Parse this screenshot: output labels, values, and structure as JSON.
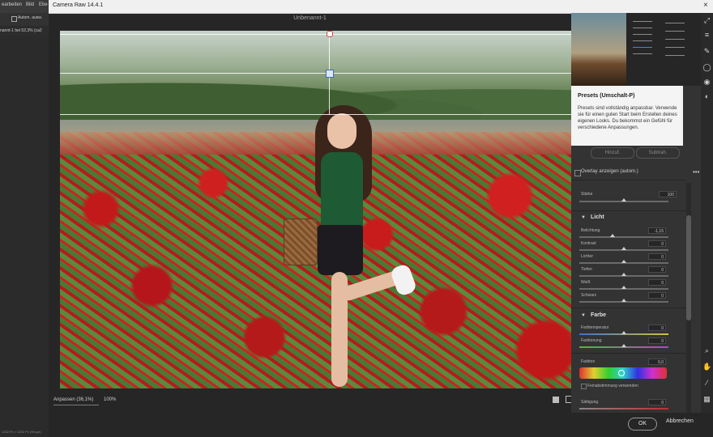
{
  "photoshop": {
    "menu": [
      "earbeiten",
      "Bild",
      "Ebe"
    ],
    "option_checkbox_label": "Autom. ausw.",
    "doc_tab": "nannt-1 bei 52,3% (ca2",
    "status": "1232 Px × 1232 Px (96 ppi)"
  },
  "camera_raw": {
    "window_title": "Camera Raw 14.4.1",
    "close_glyph": "×",
    "document_title": "Unbenannt-1",
    "zoom_menu": "Anpassen (36,1%)",
    "zoom_value": "100%"
  },
  "tooltip": {
    "title": "Presets (Umschalt-P)",
    "body": "Presets sind vollständig anpassbar. Verwende sie für einen guten Start beim Erstellen deines eigenen Looks. Du bekommst ein Gefühl für verschiedene Anpassungen."
  },
  "panel": {
    "add_label": "Hinzuf.",
    "subtract_label": "Subtrah.",
    "overlay_label": "Overlay anzeigen (autom.)",
    "more_glyph": "•••",
    "amount_label": "Stärke",
    "amount_value": "100",
    "light": {
      "title": "Licht",
      "sliders": [
        {
          "label": "Belichtung",
          "value": "-1,15"
        },
        {
          "label": "Kontrast",
          "value": "0"
        },
        {
          "label": "Lichter",
          "value": "0"
        },
        {
          "label": "Tiefen",
          "value": "0"
        },
        {
          "label": "Weiß",
          "value": "0"
        },
        {
          "label": "Schwarz",
          "value": "0"
        }
      ]
    },
    "color": {
      "title": "Farbe",
      "sliders": [
        {
          "label": "Farbtemperatur",
          "value": "0"
        },
        {
          "label": "Farbtonung",
          "value": "0"
        },
        {
          "label": "Farbton",
          "value": "0,0"
        }
      ],
      "fine_label": "Feinabstimmung verwenden",
      "saturation_label": "Sättigung",
      "saturation_value": "0"
    }
  },
  "footer": {
    "ok": "OK",
    "cancel": "Abbrechen"
  },
  "icons": [
    "expand-icon",
    "edit-icon",
    "brush-icon",
    "masking-icon",
    "redeye-icon",
    "presets-icon",
    "more-icon",
    "zoom-icon",
    "hand-icon",
    "sampler-icon",
    "grid-icon"
  ],
  "colors": {
    "accent": "#3a6fc0",
    "panel_bg": "#333333",
    "window_bg": "#262626"
  }
}
